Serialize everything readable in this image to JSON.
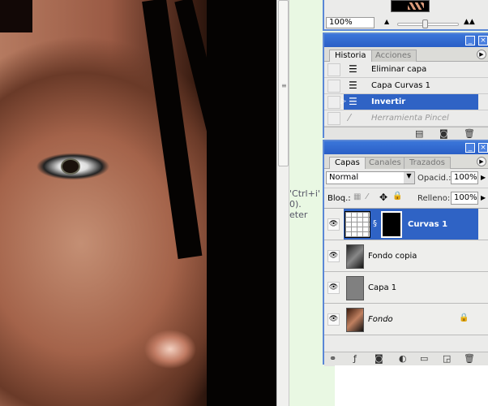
{
  "navigator": {
    "zoom": "100%"
  },
  "side_text": [
    "'Ctrl+i'",
    "0).",
    "eter"
  ],
  "history": {
    "tabs": [
      "Historia",
      "Acciones"
    ],
    "items": [
      {
        "label": "Eliminar capa",
        "state": "normal"
      },
      {
        "label": "Capa Curvas 1",
        "state": "normal"
      },
      {
        "label": "Invertir",
        "state": "selected"
      },
      {
        "label": "Herramienta Pincel",
        "state": "dimmed"
      }
    ]
  },
  "layers": {
    "tabs": [
      "Capas",
      "Canales",
      "Trazados"
    ],
    "blend_mode": "Normal",
    "opacity_label": "Opacid.:",
    "opacity": "100%",
    "lock_label": "Bloq.:",
    "fill_label": "Relleno:",
    "fill": "100%",
    "items": [
      {
        "name": "Curvas 1",
        "selected": true
      },
      {
        "name": "Fondo copia"
      },
      {
        "name": "Capa 1"
      },
      {
        "name": "Fondo",
        "italic": true,
        "locked": true
      }
    ]
  },
  "colors": {
    "accent": "#2f63c5",
    "titlebar": "#3b76d9"
  }
}
